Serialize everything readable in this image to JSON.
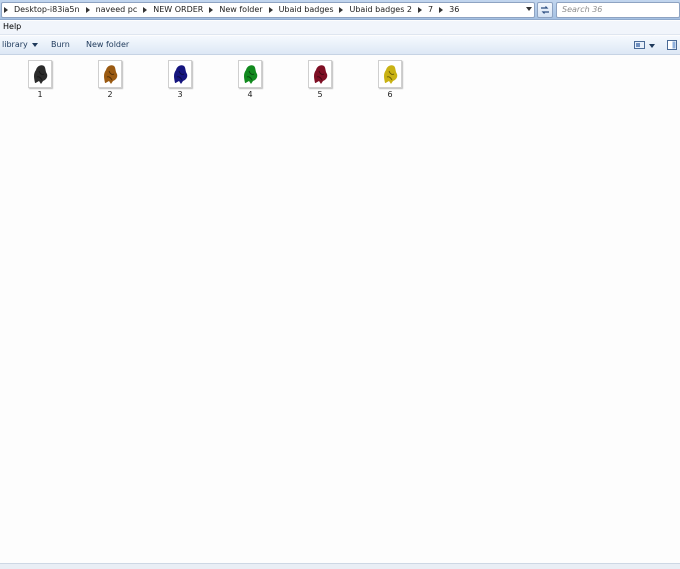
{
  "address": {
    "crumbs": [
      "Desktop-i83ia5n",
      "naveed pc",
      "NEW ORDER",
      "New folder",
      "Ubaid badges",
      "Ubaid badges 2",
      "7",
      "36"
    ]
  },
  "search": {
    "placeholder": "Search 36"
  },
  "menu": {
    "help": "Help"
  },
  "toolbar": {
    "library": "library",
    "burn": "Burn",
    "new_folder": "New folder"
  },
  "files": [
    {
      "name": "1",
      "icon": "black-badge-thumbnail",
      "color": "#2b2b2b"
    },
    {
      "name": "2",
      "icon": "brown-badge-thumbnail",
      "color": "#9a5a12"
    },
    {
      "name": "3",
      "icon": "blue-badge-thumbnail",
      "color": "#15157e"
    },
    {
      "name": "4",
      "icon": "green-badge-thumbnail",
      "color": "#128a1f"
    },
    {
      "name": "5",
      "icon": "red-badge-thumbnail",
      "color": "#7e0f24"
    },
    {
      "name": "6",
      "icon": "yellow-badge-thumbnail",
      "color": "#c9b214"
    }
  ]
}
